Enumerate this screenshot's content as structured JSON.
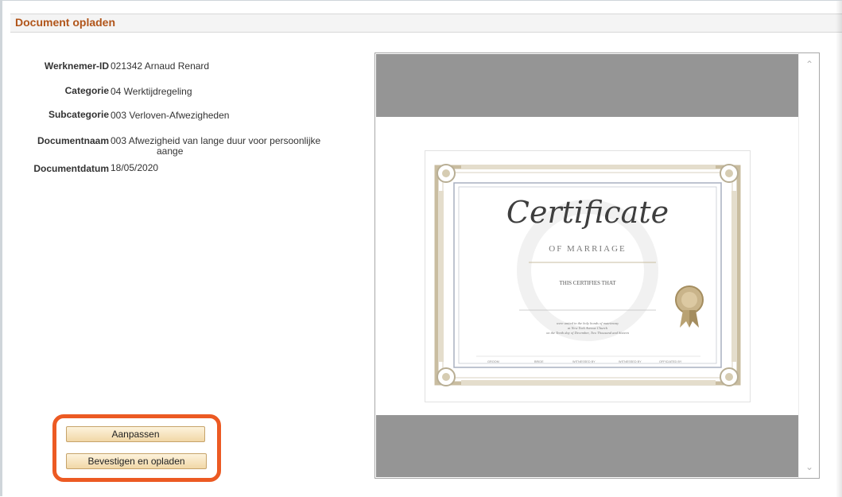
{
  "header": {
    "title": "Document opladen"
  },
  "fields": [
    {
      "label": "Werknemer-ID",
      "value": "021342  Arnaud Renard"
    },
    {
      "label": "Categorie",
      "value": "04 Werktijdregeling"
    },
    {
      "label": "Subcategorie",
      "value": "003 Verloven-Afwezigheden"
    },
    {
      "label": "Documentnaam",
      "value": "003 Afwezigheid van lange duur voor persoonlijke",
      "value_line2": "aange"
    },
    {
      "label": "Documentdatum",
      "value": "18/05/2020"
    }
  ],
  "buttons": {
    "adjust": "Aanpassen",
    "confirm_upload": "Bevestigen en opladen"
  },
  "certificate": {
    "title": "Certificate",
    "subtitle": "OF MARRIAGE",
    "certifies": "THIS CERTIFIES THAT",
    "body_line1": "were united in the holy bonds of matrimony",
    "body_line2": "at New York Avenue Church",
    "body_line3": "on the Tenth day of December, Two Thousand and Sixteen",
    "signatures": [
      "GROOM",
      "BRIDE",
      "WITNESSED BY",
      "WITNESSED BY",
      "OFFICIATED BY"
    ]
  },
  "colors": {
    "header_title": "#b1551a",
    "highlight_border": "#ec5a23",
    "viewer_gray": "#959595",
    "button_fill": "#f1d7a6"
  }
}
